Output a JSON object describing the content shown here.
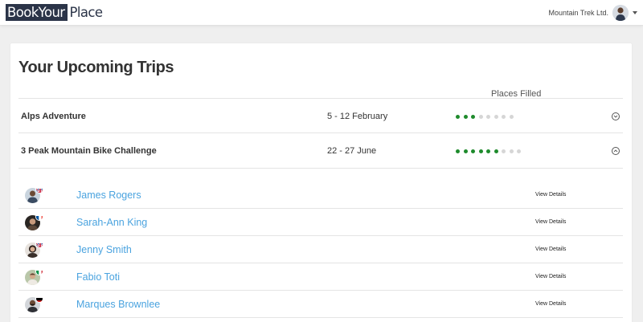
{
  "header": {
    "logo_box": "BookYour",
    "logo_rest": "Place",
    "company": "Mountain Trek Ltd."
  },
  "main": {
    "title": "Your Upcoming Trips",
    "places_filled_label": "Places Filled",
    "trips": [
      {
        "name": "Alps Adventure",
        "dates": "5 - 12 February",
        "filled": 3,
        "capacity": 8,
        "expanded": false
      },
      {
        "name": "3 Peak Mountain Bike Challenge",
        "dates": "22 - 27 June",
        "filled": 6,
        "capacity": 9,
        "expanded": true
      }
    ],
    "participants": [
      {
        "name": "James Rogers",
        "flag": "uk-flag",
        "details_label": "View Details"
      },
      {
        "name": "Sarah-Ann King",
        "flag": "france-flag",
        "details_label": "View Details"
      },
      {
        "name": "Jenny Smith",
        "flag": "uk-flag",
        "details_label": "View Details"
      },
      {
        "name": "Fabio Toti",
        "flag": "italy-flag",
        "details_label": "View Details"
      },
      {
        "name": "Marques Brownlee",
        "flag": "germany-flag",
        "details_label": "View Details"
      }
    ]
  },
  "colors": {
    "dot_filled": "#1e8b2c",
    "dot_empty": "#d6d6d6",
    "link": "#4aa3df",
    "logo_dark": "#2b3448"
  }
}
